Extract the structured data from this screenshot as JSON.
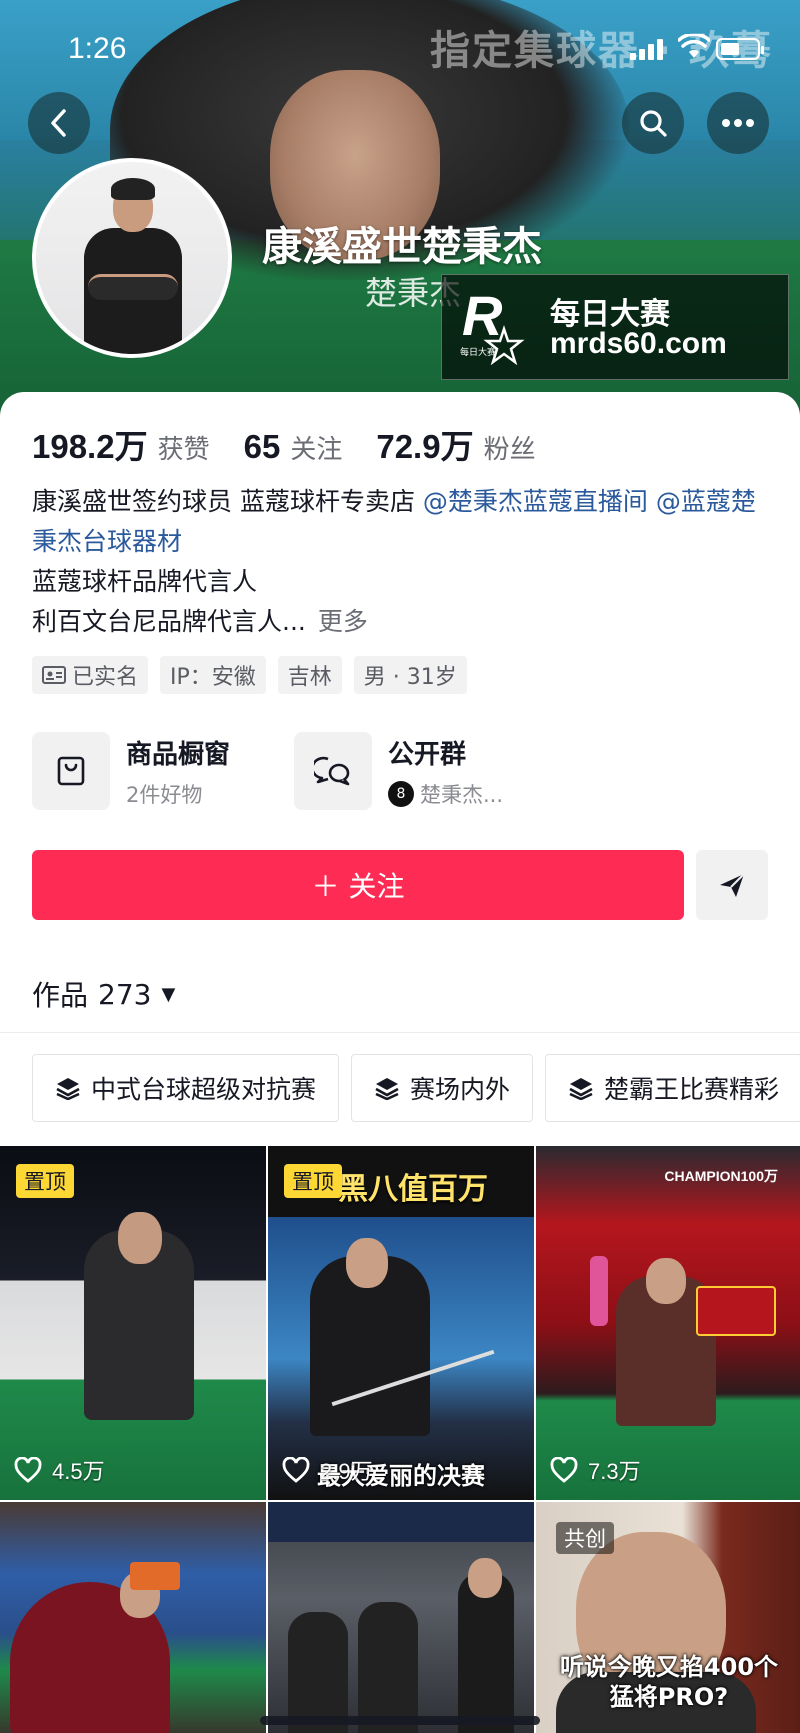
{
  "status_bar": {
    "time": "1:26"
  },
  "banner": {
    "sign_text": "指定集球器 · 玖蓦"
  },
  "profile": {
    "display_name": "康溪盛世楚秉杰",
    "sub_name": "楚秉杰"
  },
  "watermark": {
    "brand": "每日大赛",
    "url": "mrds60.com",
    "logo_letter": "R",
    "logo_small": "每日大赛"
  },
  "stats": [
    {
      "value": "198.2万",
      "label": "获赞"
    },
    {
      "value": "65",
      "label": "关注"
    },
    {
      "value": "72.9万",
      "label": "粉丝"
    }
  ],
  "bio": {
    "line1_text": "康溪盛世签约球员 蓝蔻球杆专卖店",
    "mention1": "@楚秉杰蓝蔻直播间",
    "mention2": "@蓝蔻楚秉杰台球器材",
    "line3": "蓝蔻球杆品牌代言人",
    "line4": "利百文台尼品牌代言人...",
    "more": "更多"
  },
  "tags": [
    {
      "label": "已实名",
      "icon": "id-card-icon"
    },
    {
      "label": "IP：安徽"
    },
    {
      "label": "吉林"
    },
    {
      "label": "男 · 31岁"
    }
  ],
  "shortcuts": {
    "shop": {
      "title": "商品橱窗",
      "subtitle": "2件好物",
      "icon": "shopping-bag-icon"
    },
    "group": {
      "title": "公开群",
      "subtitle": "楚秉杰...",
      "icon": "chat-bubbles-icon",
      "ball_number": "8"
    }
  },
  "actions": {
    "follow_label": "＋ 关注",
    "share_icon": "paper-plane-icon"
  },
  "works": {
    "label": "作品",
    "count": "273",
    "caret": "▼"
  },
  "collections": [
    {
      "label": "中式台球超级对抗赛",
      "icon": "stack-icon"
    },
    {
      "label": "赛场内外",
      "icon": "stack-icon"
    },
    {
      "label": "楚霸王比赛精彩",
      "icon": "stack-icon"
    }
  ],
  "videos": [
    {
      "pin": "置顶",
      "likes": "4.5万"
    },
    {
      "pin": "置顶",
      "likes": "2.9万",
      "title": "黑八值百万",
      "caption": "最大爱丽的决赛"
    },
    {
      "likes": "7.3万",
      "banner": "CHAMPION100万"
    },
    {},
    {},
    {
      "badge": "共创",
      "caption": "听说今晚又掐400个\n猛将PRO?"
    }
  ],
  "colors": {
    "accent": "#fe2c55",
    "mention": "#2b5a9c",
    "pin": "#fdd835"
  }
}
